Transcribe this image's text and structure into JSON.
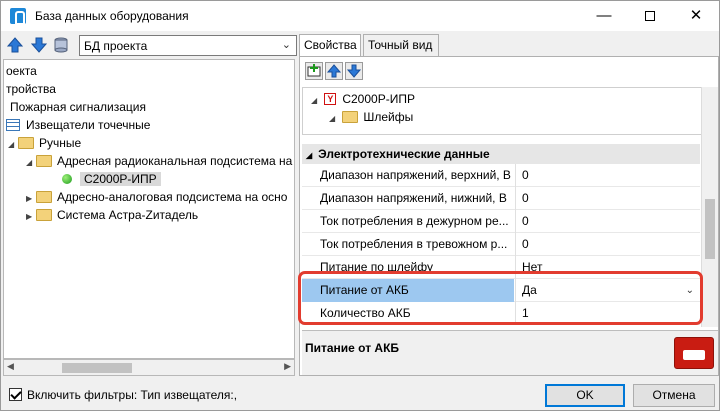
{
  "window": {
    "title": "База данных оборудования",
    "minimize": "—",
    "close": "✕"
  },
  "left": {
    "db_combo": "БД проекта",
    "tree": [
      {
        "label": "оекта"
      },
      {
        "label": "тройства"
      },
      {
        "label": "Пожарная сигнализация"
      },
      {
        "label": "Извещатели точечные"
      },
      {
        "label": "Ручные"
      },
      {
        "label": "Адресная радиоканальная подсистема на"
      },
      {
        "label": "С2000Р-ИПР"
      },
      {
        "label": "Адресно-аналоговая подсистема на осно"
      },
      {
        "label": "Система Астра-Zитадель"
      }
    ]
  },
  "right": {
    "tabs": [
      "Свойства",
      "Точный вид"
    ],
    "mini_tree": [
      {
        "label": "С2000Р-ИПР"
      },
      {
        "label": "Шлейфы"
      }
    ],
    "category": "Электротехнические данные",
    "rows": [
      {
        "name": "Диапазон напряжений, верхний, В",
        "value": "0"
      },
      {
        "name": "Диапазон напряжений, нижний, В",
        "value": "0"
      },
      {
        "name": "Ток потребления в дежурном ре...",
        "value": "0"
      },
      {
        "name": "Ток потребления в тревожном р...",
        "value": "0"
      },
      {
        "name": "Питание по шлейфу",
        "value": "Нет"
      },
      {
        "name": "Питание от АКБ",
        "value": "Да"
      },
      {
        "name": "Количество АКБ",
        "value": "1"
      }
    ],
    "description_title": "Питание от АКБ"
  },
  "footer": {
    "filter_label": "Включить фильтры: Тип извещателя:,",
    "ok": "OK",
    "cancel": "Отмена"
  },
  "colors": {
    "selection": "#9dc8f0",
    "highlight": "#e23c2f",
    "accent": "#0078d7"
  }
}
